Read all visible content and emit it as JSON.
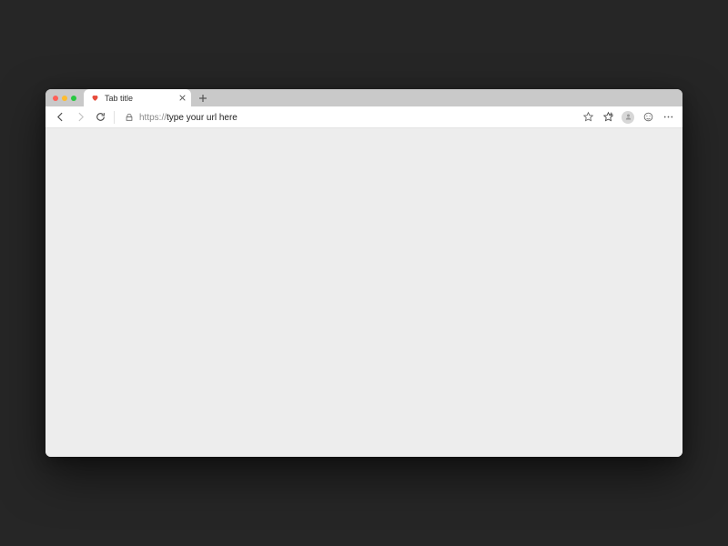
{
  "tab": {
    "title": "Tab title",
    "favicon": "heart-icon"
  },
  "addressbar": {
    "protocol": "https://",
    "rest": "type your url here"
  },
  "icons": {
    "back": "back-icon",
    "forward": "forward-icon",
    "refresh": "refresh-icon",
    "lock": "lock-icon",
    "favorite": "star-icon",
    "favorites_list": "star-plus-icon",
    "profile": "profile-icon",
    "feedback": "face-icon",
    "more": "more-icon",
    "close_tab": "close-icon",
    "new_tab": "plus-icon"
  }
}
